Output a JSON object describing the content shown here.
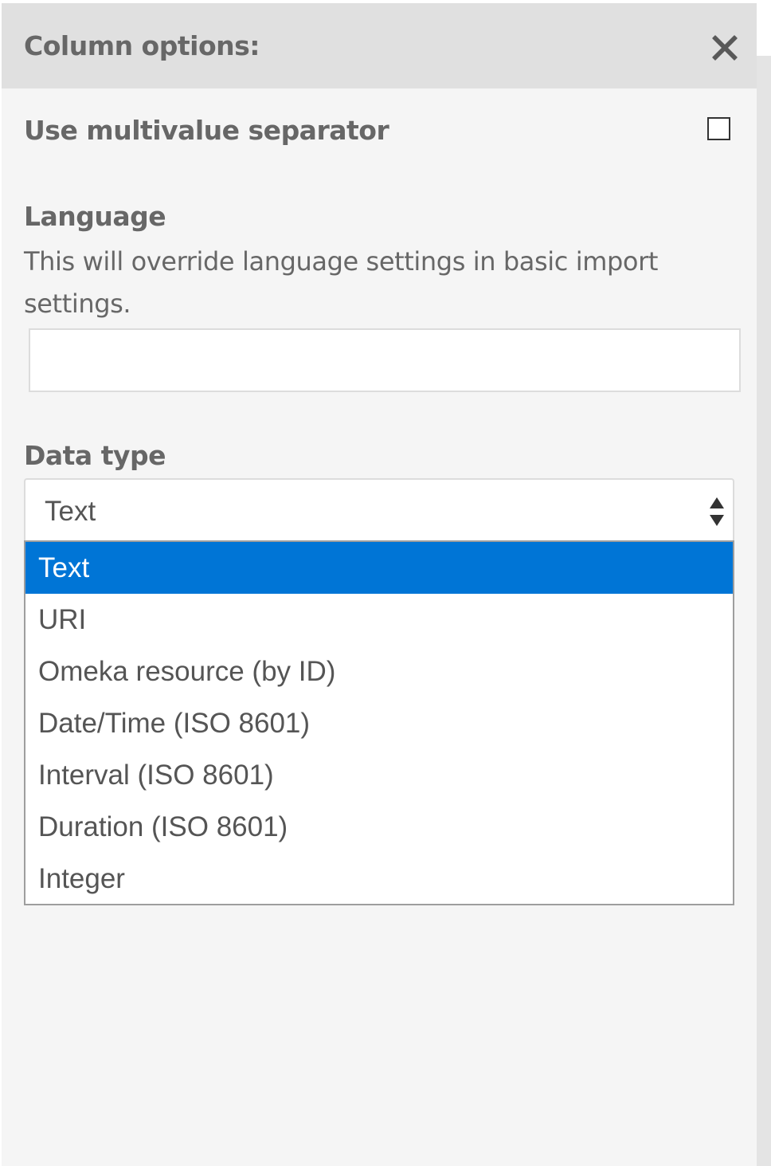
{
  "panel": {
    "title": "Column options:",
    "close_icon": "close-icon"
  },
  "multivalue": {
    "label": "Use multivalue separator",
    "checked": false
  },
  "language": {
    "label": "Language",
    "help": "This will override language settings in basic import settings.",
    "value": "",
    "placeholder": ""
  },
  "data_type": {
    "label": "Data type",
    "selected": "Text",
    "arrows_icon": "select-arrows-icon",
    "options": [
      "Text",
      "URI",
      "Omeka resource (by ID)",
      "Date/Time (ISO 8601)",
      "Interval (ISO 8601)",
      "Duration (ISO 8601)",
      "Integer"
    ],
    "highlighted_index": 0
  },
  "colors": {
    "header_bg": "#e0e0e0",
    "panel_bg": "#f5f5f5",
    "text": "#676767",
    "highlight": "#0075d6"
  }
}
